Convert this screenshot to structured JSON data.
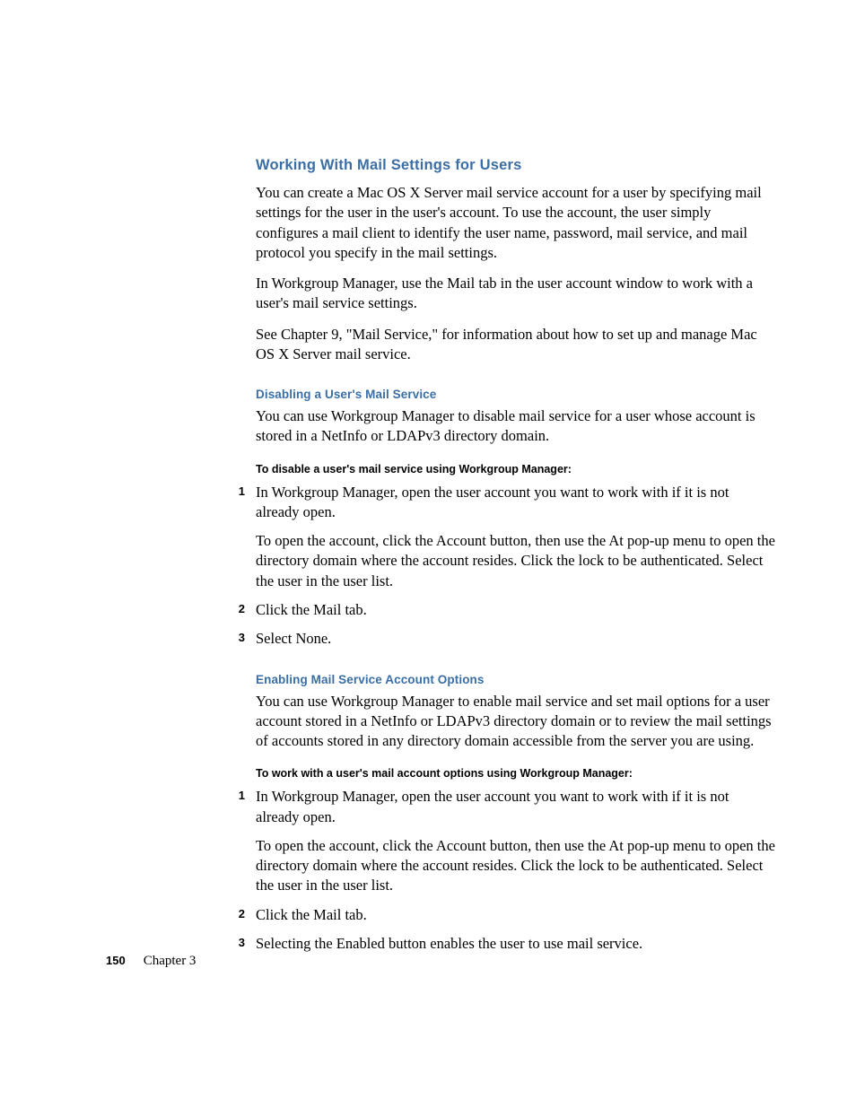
{
  "heading1": "Working With Mail Settings for Users",
  "para1": "You can create a Mac OS X Server mail service account for a user by specifying mail settings for the user in the user's account. To use the account, the user simply configures a mail client to identify the user name, password, mail service, and mail protocol you specify in the mail settings.",
  "para2": "In Workgroup Manager, use the Mail tab in the user account window to work with a user's mail service settings.",
  "para3": "See Chapter 9, \"Mail Service,\" for information about how to set up and manage Mac OS X Server mail service.",
  "sectionA": {
    "title": "Disabling a User's Mail Service",
    "intro": "You can use Workgroup Manager to disable mail service for a user whose account is stored in a NetInfo or LDAPv3 directory domain.",
    "procedure_title": "To disable a user's mail service using Workgroup Manager:",
    "steps": [
      {
        "num": "1",
        "paras": [
          "In Workgroup Manager, open the user account you want to work with if it is not already open.",
          "To open the account, click the Account button, then use the At pop-up menu to open the directory domain where the account resides. Click the lock to be authenticated. Select the user in the user list."
        ]
      },
      {
        "num": "2",
        "paras": [
          "Click the Mail tab."
        ]
      },
      {
        "num": "3",
        "paras": [
          "Select None."
        ]
      }
    ]
  },
  "sectionB": {
    "title": "Enabling Mail Service Account Options",
    "intro": "You can use Workgroup Manager to enable mail service and set mail options for a user account stored in a NetInfo or LDAPv3 directory domain or to review the mail settings of accounts stored in any directory domain accessible from the server you are using.",
    "procedure_title": "To work with a user's mail account options using Workgroup Manager:",
    "steps": [
      {
        "num": "1",
        "paras": [
          "In Workgroup Manager, open the user account you want to work with if it is not already open.",
          "To open the account, click the Account button, then use the At pop-up menu to open the directory domain where the account resides. Click the lock to be authenticated. Select the user in the user list."
        ]
      },
      {
        "num": "2",
        "paras": [
          "Click the Mail tab."
        ]
      },
      {
        "num": "3",
        "paras": [
          "Selecting the Enabled button enables the user to use mail service."
        ]
      }
    ]
  },
  "footer": {
    "page_number": "150",
    "chapter": "Chapter 3"
  }
}
